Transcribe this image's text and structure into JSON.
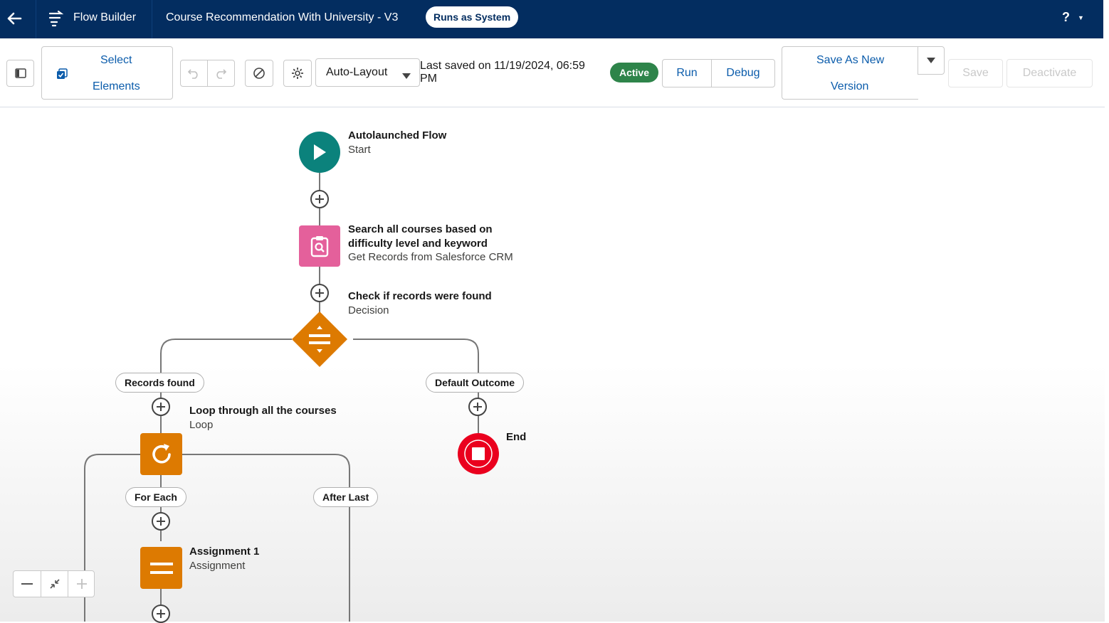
{
  "header": {
    "app_name": "Flow Builder",
    "flow_name": "Course Recommendation With University - V3",
    "run_mode": "Runs as System",
    "help_label": "?"
  },
  "toolbar": {
    "select_elements_line1": "Select",
    "select_elements_line2": "Elements",
    "layout_mode": "Auto-Layout",
    "last_saved_line1": "Last saved on 11/19/2024, 06:59",
    "last_saved_line2": "PM",
    "status": "Active",
    "run_label": "Run",
    "debug_label": "Debug",
    "save_as_line1": "Save As New",
    "save_as_line2": "Version",
    "save_label": "Save",
    "deactivate_label": "Deactivate"
  },
  "flow": {
    "start": {
      "title": "Autolaunched Flow",
      "subtitle": "Start"
    },
    "get_records": {
      "title_line1": "Search all courses based on",
      "title_line2": "difficulty level and keyword",
      "subtitle": "Get Records from Salesforce CRM"
    },
    "decision": {
      "title": "Check if records were found",
      "subtitle": "Decision"
    },
    "outcome_found": "Records found",
    "outcome_default": "Default Outcome",
    "loop": {
      "title": "Loop through all the courses",
      "subtitle": "Loop"
    },
    "end": {
      "title": "End"
    },
    "for_each": "For Each",
    "after_last": "After Last",
    "assignment": {
      "title": "Assignment 1",
      "subtitle": "Assignment"
    }
  },
  "colors": {
    "header_bg": "#032d60",
    "start_node": "#0b827c",
    "get_records_node": "#e4609b",
    "decision_node": "#dd7a01",
    "loop_node": "#dd7a01",
    "assignment_node": "#dd7a01",
    "end_node": "#ea001e",
    "active_badge": "#2e844a"
  }
}
